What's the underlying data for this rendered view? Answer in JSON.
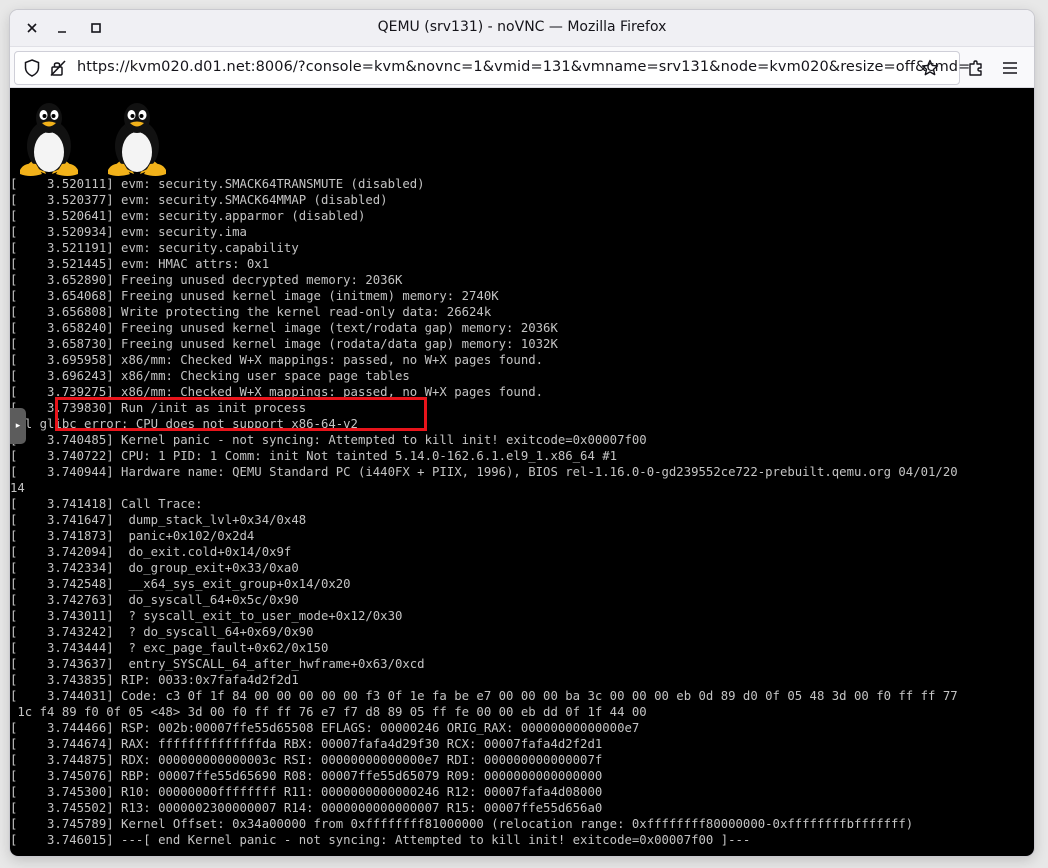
{
  "window": {
    "title": "QEMU (srv131) - noVNC — Mozilla Firefox"
  },
  "urlbar": {
    "url": "https://kvm020.d01.net:8006/?console=kvm&novnc=1&vmid=131&vmname=srv131&node=kvm020&resize=off&cmd="
  },
  "icons": {
    "minimize": "minimize-icon",
    "maximize": "maximize-icon",
    "close": "close-icon",
    "shield": "tracking-protection-shield-icon",
    "lock": "insecure-lock-icon",
    "star": "bookmark-star-icon",
    "extensions": "extensions-puzzle-icon",
    "menu": "hamburger-menu-icon",
    "tux": "tux-penguin-logo",
    "sidebar_handle": "chevron-right-icon"
  },
  "colors": {
    "console_bg": "#000000",
    "console_text": "#c4c4c4",
    "highlight_border": "#e8141b"
  },
  "novnc": {
    "handle_glyph": "▸"
  },
  "console_lines": [
    "[    3.520111] evm: security.SMACK64TRANSMUTE (disabled)",
    "[    3.520377] evm: security.SMACK64MMAP (disabled)",
    "[    3.520641] evm: security.apparmor (disabled)",
    "[    3.520934] evm: security.ima",
    "[    3.521191] evm: security.capability",
    "[    3.521445] evm: HMAC attrs: 0x1",
    "[    3.652890] Freeing unused decrypted memory: 2036K",
    "[    3.654068] Freeing unused kernel image (initmem) memory: 2740K",
    "[    3.656808] Write protecting the kernel read-only data: 26624k",
    "[    3.658240] Freeing unused kernel image (text/rodata gap) memory: 2036K",
    "[    3.658730] Freeing unused kernel image (rodata/data gap) memory: 1032K",
    "[    3.695958] x86/mm: Checked W+X mappings: passed, no W+X pages found.",
    "[    3.696243] x86/mm: Checking user space page tables",
    "[    3.739275] x86/mm: Checked W+X mappings: passed, no W+X pages found.",
    "[    3.739830] Run /init as init process",
    "tal glibc error: CPU does not support x86-64-v2",
    "[    3.740485] Kernel panic - not syncing: Attempted to kill init! exitcode=0x00007f00",
    "[    3.740722] CPU: 1 PID: 1 Comm: init Not tainted 5.14.0-162.6.1.el9_1.x86_64 #1",
    "[    3.740944] Hardware name: QEMU Standard PC (i440FX + PIIX, 1996), BIOS rel-1.16.0-0-gd239552ce722-prebuilt.qemu.org 04/01/20",
    "14",
    "[    3.741418] Call Trace:",
    "[    3.741647]  dump_stack_lvl+0x34/0x48",
    "[    3.741873]  panic+0x102/0x2d4",
    "[    3.742094]  do_exit.cold+0x14/0x9f",
    "[    3.742334]  do_group_exit+0x33/0xa0",
    "[    3.742548]  __x64_sys_exit_group+0x14/0x20",
    "[    3.742763]  do_syscall_64+0x5c/0x90",
    "[    3.743011]  ? syscall_exit_to_user_mode+0x12/0x30",
    "[    3.743242]  ? do_syscall_64+0x69/0x90",
    "[    3.743444]  ? exc_page_fault+0x62/0x150",
    "[    3.743637]  entry_SYSCALL_64_after_hwframe+0x63/0xcd",
    "[    3.743835] RIP: 0033:0x7fafa4d2f2d1",
    "[    3.744031] Code: c3 0f 1f 84 00 00 00 00 00 f3 0f 1e fa be e7 00 00 00 ba 3c 00 00 00 eb 0d 89 d0 0f 05 48 3d 00 f0 ff ff 77",
    " 1c f4 89 f0 0f 05 <48> 3d 00 f0 ff ff 76 e7 f7 d8 89 05 ff fe 00 00 eb dd 0f 1f 44 00",
    "[    3.744466] RSP: 002b:00007ffe55d65508 EFLAGS: 00000246 ORIG_RAX: 00000000000000e7",
    "[    3.744674] RAX: ffffffffffffffda RBX: 00007fafa4d29f30 RCX: 00007fafa4d2f2d1",
    "[    3.744875] RDX: 000000000000003c RSI: 00000000000000e7 RDI: 000000000000007f",
    "[    3.745076] RBP: 00007ffe55d65690 R08: 00007ffe55d65079 R09: 0000000000000000",
    "[    3.745300] R10: 00000000ffffffff R11: 0000000000000246 R12: 00007fafa4d08000",
    "[    3.745502] R13: 0000002300000007 R14: 0000000000000007 R15: 00007ffe55d656a0",
    "[    3.745789] Kernel Offset: 0x34a00000 from 0xffffffff81000000 (relocation range: 0xffffffff80000000-0xffffffffbfffffff)",
    "[    3.746015] ---[ end Kernel panic - not syncing: Attempted to kill init! exitcode=0x00007f00 ]---"
  ]
}
